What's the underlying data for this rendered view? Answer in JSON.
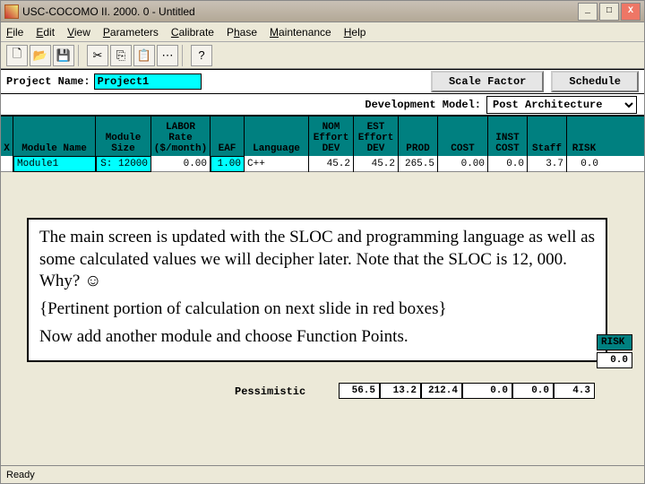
{
  "title": "USC-COCOMO II. 2000. 0 - Untitled",
  "menus": [
    "File",
    "Edit",
    "View",
    "Parameters",
    "Calibrate",
    "Phase",
    "Maintenance",
    "Help"
  ],
  "toolbar_icons": [
    "new",
    "open",
    "save",
    "cut",
    "copy",
    "paste",
    "props",
    "help"
  ],
  "project_label": "Project Name:",
  "project_name": "Project1",
  "btn_scale": "Scale Factor",
  "btn_sched": "Schedule",
  "dev_label": "Development Model:",
  "dev_value": "Post Architecture",
  "headers": {
    "x": "X",
    "name": "Module Name",
    "size": "Module\nSize",
    "labor": "LABOR\nRate\n($/month)",
    "eaf": "EAF",
    "lang": "Language",
    "nom": "NOM\nEffort\nDEV",
    "est": "EST\nEffort\nDEV",
    "prod": "PROD",
    "cost": "COST",
    "inst": "INST\nCOST",
    "staff": "Staff",
    "risk": "RISK"
  },
  "row": {
    "name": "Module1",
    "size": "S: 12000",
    "labor": "0.00",
    "eaf": "1.00",
    "lang": "C++",
    "nom": "45.2",
    "est": "45.2",
    "prod": "265.5",
    "cost": "0.00",
    "inst": "0.0",
    "staff": "3.7",
    "risk": "0.0"
  },
  "overlay": {
    "p1": "The main screen is updated with the SLOC and programming language as well as some calculated values we will decipher later. Note that the SLOC is 12, 000. Why? ☺",
    "p2": "{Pertinent portion of calculation on next slide in red boxes}",
    "p3": "Now add another module and choose Function Points."
  },
  "risk_header": "RISK",
  "pess_label": "Pessimistic",
  "sum": {
    "a": "56.5",
    "b": "13.2",
    "c": "212.4",
    "d": "0.0",
    "e": "0.0",
    "f": "4.3",
    "g": "0.0"
  },
  "status": "Ready"
}
